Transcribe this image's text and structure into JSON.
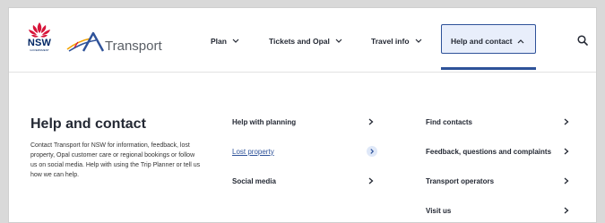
{
  "brand": {
    "nsw_text": "NSW",
    "nsw_sub": "GOVERNMENT",
    "transport_text": "Transport"
  },
  "nav": {
    "items": [
      {
        "label": "Plan"
      },
      {
        "label": "Tickets and Opal"
      },
      {
        "label": "Travel info"
      },
      {
        "label": "Help and contact"
      }
    ]
  },
  "panel": {
    "title": "Help and contact",
    "description": "Contact Transport for NSW for information, feedback, lost property, Opal customer care or regional bookings or follow us on social media. Help with using the Trip Planner or tell us how we can help."
  },
  "links_col1": [
    {
      "label": "Help with planning"
    },
    {
      "label": "Lost property"
    },
    {
      "label": "Social media"
    }
  ],
  "links_col2": [
    {
      "label": "Find contacts"
    },
    {
      "label": "Feedback, questions and complaints"
    },
    {
      "label": "Transport operators"
    },
    {
      "label": "Visit us"
    }
  ],
  "colors": {
    "accent": "#2e5299",
    "text": "#242934",
    "nsw_red": "#d7153a",
    "nsw_blue": "#002664"
  }
}
